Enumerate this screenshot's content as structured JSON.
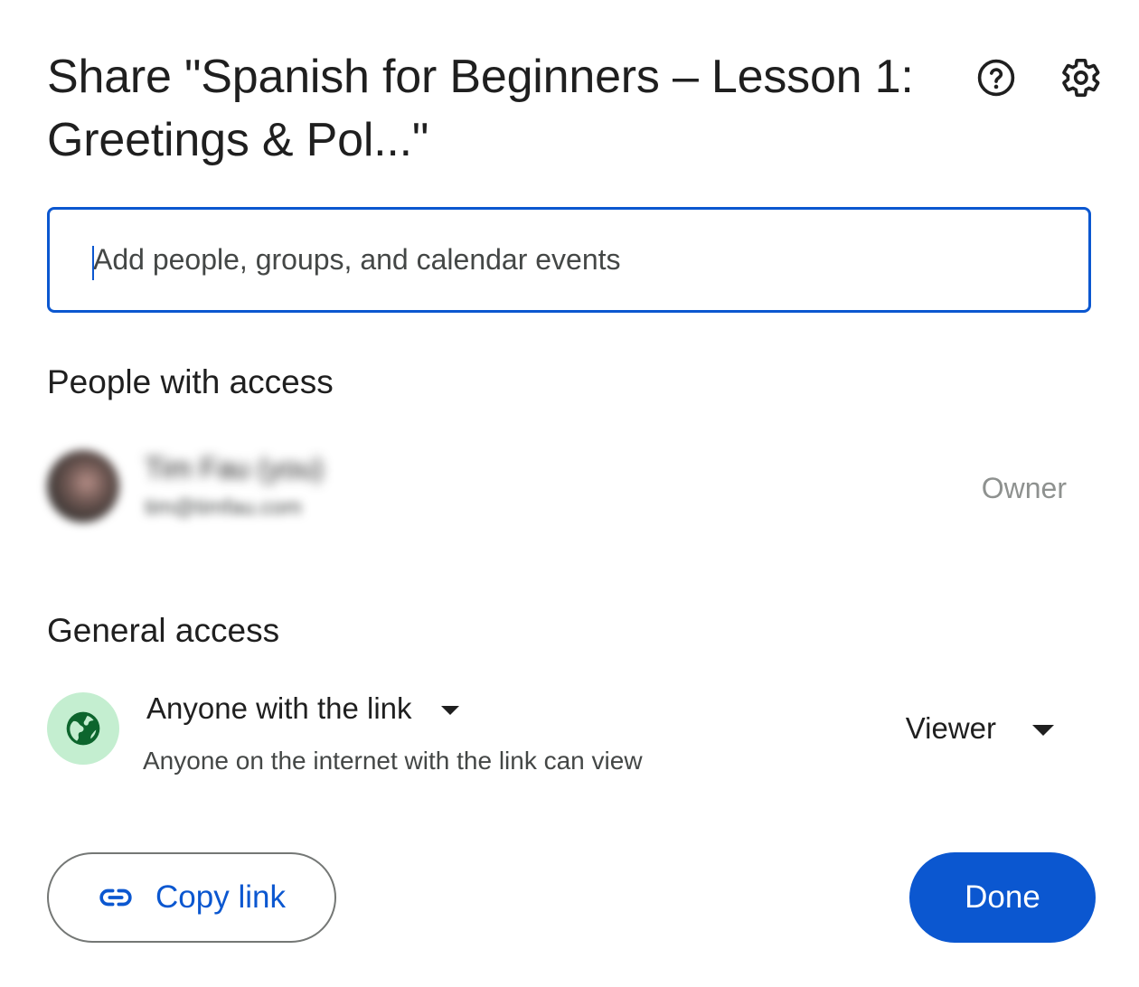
{
  "dialog": {
    "title": "Share \"Spanish for Beginners – Lesson 1: Greetings & Pol...\"",
    "help_icon": "help-circle-icon",
    "settings_icon": "gear-icon"
  },
  "add_people": {
    "value": "",
    "placeholder": "Add people, groups, and calendar events"
  },
  "people_with_access": {
    "heading": "People with access",
    "people": [
      {
        "name": "Tim Fau (you)",
        "email": "tim@timfau.com",
        "role": "Owner"
      }
    ]
  },
  "general_access": {
    "heading": "General access",
    "icon": "globe-icon",
    "scope": "Anyone with the link",
    "description": "Anyone on the internet with the link can view",
    "role": "Viewer"
  },
  "footer": {
    "copy_link_label": "Copy link",
    "copy_link_icon": "link-icon",
    "done_label": "Done"
  },
  "colors": {
    "accent": "#0b57d0",
    "globe_bg": "#c4eed0",
    "globe_fg": "#0d652d",
    "text": "#1f1f1f",
    "muted": "#8e918f"
  }
}
